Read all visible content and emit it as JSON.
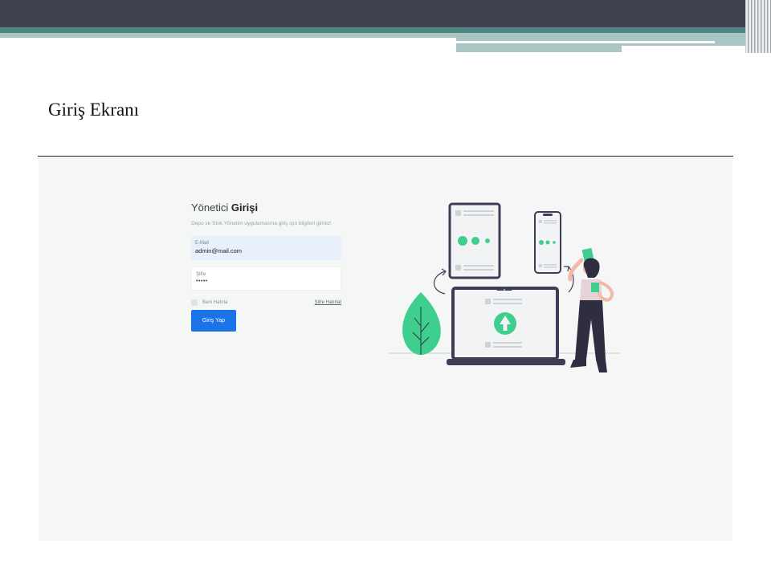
{
  "slide": {
    "title": "Giriş Ekranı"
  },
  "login": {
    "title_prefix": "Yönetici",
    "title_strong": "Girişi",
    "description": "Depo ve Stok Yönetim uygulamasına giriş için bilgileri giriniz!",
    "email": {
      "label": "E-Mail",
      "value": "admin@mail.com"
    },
    "password": {
      "label": "Şifre",
      "value": "•••••"
    },
    "remember_label": "Beni Hatırla",
    "forgot_label": "Şifre Hatırlat",
    "submit_label": "Giriş Yap"
  },
  "colors": {
    "top_bar": "#404250",
    "accent_teal": "#4f8481",
    "light_teal": "#a9c6c4",
    "screen_bg": "#f4f7f6",
    "button_blue": "#1b73e8",
    "illustration_green": "#3ecf8e",
    "email_field_bg": "#e8f0fc"
  },
  "illustration": {
    "subject": "woman-with-devices-illustration"
  }
}
